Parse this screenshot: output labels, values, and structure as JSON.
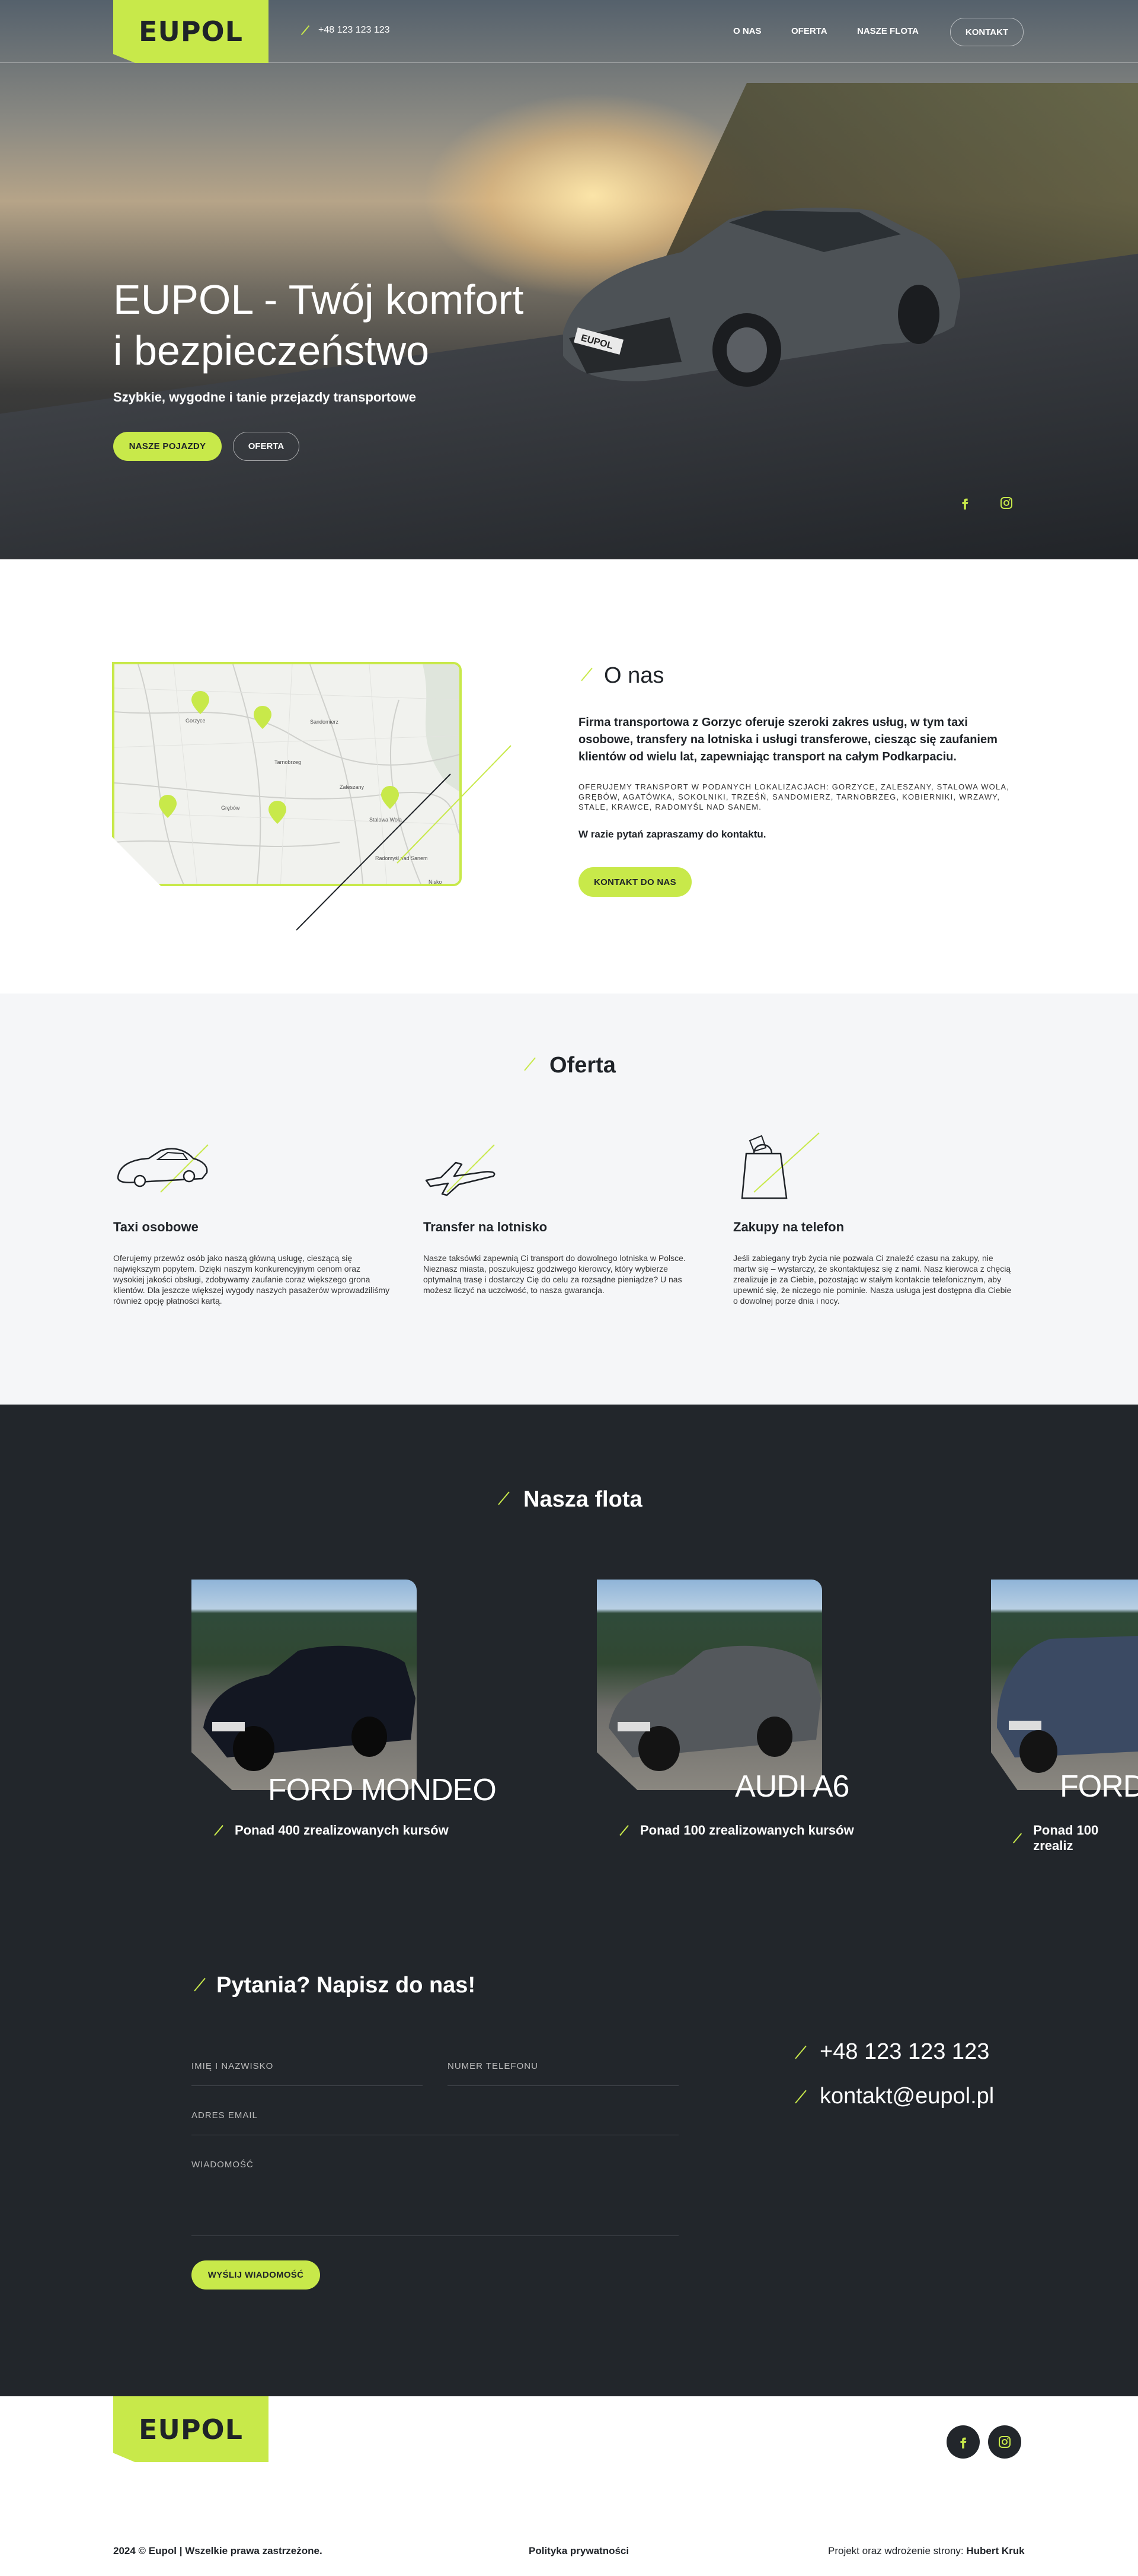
{
  "header": {
    "logo": "EUPOL",
    "phone": "+48 123 123 123",
    "nav": [
      "O NAS",
      "OFERTA",
      "NASZE FLOTA",
      "KONTAKT"
    ]
  },
  "hero": {
    "title_line1": "EUPOL - Twój komfort",
    "title_line2": "i bezpieczeństwo",
    "subtitle": "Szybkie, wygodne i tanie przejazdy transportowe",
    "btn_fleet": "NASZE POJAZDY",
    "btn_offer": "OFERTA",
    "plate": "EUPOL"
  },
  "about": {
    "title": "O nas",
    "lead": "Firma transportowa z Gorzyc oferuje szeroki zakres usług, w tym taxi osobowe, transfery na lotniska i usługi transferowe, ciesząc się zaufaniem klientów od wielu lat, zapewniając transport na całym Podkarpaciu.",
    "places": "OFERUJEMY TRANSPORT W PODANYCH LOKALIZACJACH: GORZYCE, ZALESZANY, STALOWA WOLA, GRĘBÓW, AGATÓWKA, SOKOLNIKI, TRZEŚŃ, SANDOMIERZ, TARNOBRZEG, KOBIERNIKI, WRZAWY, STALE, KRAWCE, RADOMYŚL NAD SANEM.",
    "ask": "W razie pytań zapraszamy do kontaktu.",
    "btn": "KONTAKT DO NAS"
  },
  "map_labels": [
    "Gorzyce",
    "Sandomierz",
    "Tarnobrzeg",
    "Stalowa Wola",
    "Radomyśl nad Sanem",
    "Grębów",
    "Zaleszany",
    "Nisko"
  ],
  "offer": {
    "title": "Oferta",
    "items": [
      {
        "title": "Taxi osobowe",
        "text": "Oferujemy przewóz osób jako naszą główną usługę, cieszącą się największym popytem. Dzięki naszym konkurencyjnym cenom oraz wysokiej jakości obsługi, zdobywamy zaufanie coraz większego grona klientów. Dla jeszcze większej wygody naszych pasażerów wprowadziliśmy również opcję płatności kartą.",
        "icon": "car-icon"
      },
      {
        "title": "Transfer na lotnisko",
        "text": "Nasze taksówki zapewnią Ci transport do dowolnego lotniska w Polsce. Nieznasz miasta, poszukujesz godziwego kierowcy, który wybierze optymalną trasę i dostarczy Cię do celu za rozsądne pieniądze? U nas możesz liczyć na uczciwość, to nasza gwarancja.",
        "icon": "airplane-icon"
      },
      {
        "title": "Zakupy na telefon",
        "text": "Jeśli zabiegany tryb życia nie pozwala Ci znaleźć czasu na zakupy, nie martw się – wystarczy, że skontaktujesz się z nami. Nasz kierowca z chęcią zrealizuje je za Ciebie, pozostając w stałym kontakcie telefonicznym, aby upewnić się, że niczego nie pominie. Nasza usługa jest dostępna dla Ciebie o dowolnej porze dnia i nocy.",
        "icon": "shopping-bag-icon"
      }
    ]
  },
  "fleet": {
    "title": "Nasza flota",
    "cars": [
      {
        "name": "FORD MONDEO",
        "count": "Ponad 400 zrealizowanych kursów"
      },
      {
        "name": "AUDI A6",
        "count": "Ponad 100 zrealizowanych kursów"
      },
      {
        "name": "FORD",
        "count": "Ponad 100 zrealiz"
      }
    ]
  },
  "contact": {
    "title": "Pytania? Napisz do nas!",
    "fields": {
      "name": "IMIĘ I NAZWISKO",
      "phone": "NUMER TELEFONU",
      "email": "ADRES EMAIL",
      "message": "WIADOMOŚĆ"
    },
    "btn": "WYŚLIJ WIADOMOŚĆ",
    "phone": "+48 123 123 123",
    "email": "kontakt@eupol.pl"
  },
  "footer": {
    "logo": "EUPOL",
    "copyright": "2024 © Eupol | Wszelkie prawa zastrzeżone.",
    "privacy": "Polityka prywatności",
    "credit_label": "Projekt oraz wdrożenie strony:",
    "credit_name": "Hubert Kruk"
  },
  "colors": {
    "accent": "#c8e94a",
    "dark": "#22262b",
    "light": "#f5f6f8"
  }
}
